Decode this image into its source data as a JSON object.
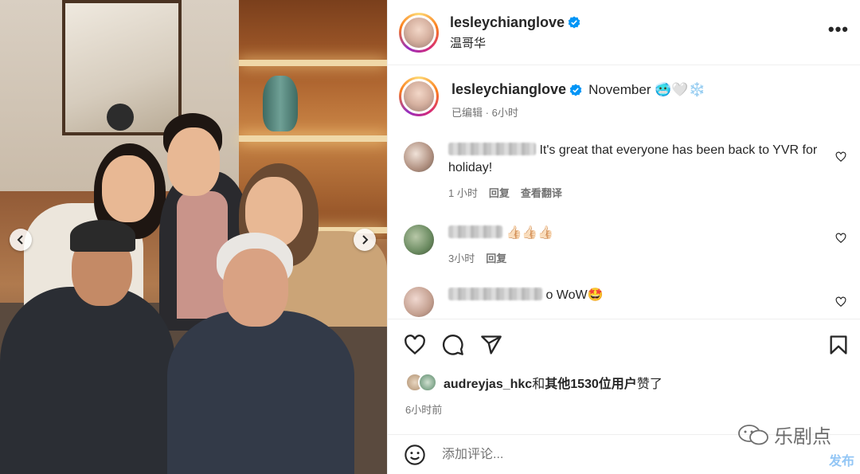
{
  "header": {
    "username": "lesleychianglove",
    "location": "温哥华",
    "more_label": "•••"
  },
  "caption": {
    "username": "lesleychianglove",
    "text": "November 🥶🤍❄️",
    "edited_label": "已编辑",
    "separator": "·",
    "time": "6小时"
  },
  "comments": [
    {
      "text": "It's great that everyone has been back to YVR for holiday!",
      "time": "1 小时",
      "reply_label": "回复",
      "translate_label": "查看翻译"
    },
    {
      "text": "👍🏻👍🏻👍🏻",
      "time": "3小时",
      "reply_label": "回复"
    },
    {
      "text": "o WoW🤩"
    }
  ],
  "likes": {
    "user": "audreyjas_hkc",
    "connector": "和",
    "others": "其他1530位用户",
    "suffix": "赞了"
  },
  "post_time": "6小时前",
  "add_comment": {
    "placeholder": "添加评论...",
    "post_label": "发布"
  },
  "watermark": {
    "text": "乐剧点"
  },
  "colors": {
    "verified": "#0095f6",
    "post_button": "#93c6f5",
    "secondary_text": "#737373"
  },
  "icons": {
    "like": "heart-icon",
    "comment": "comment-icon",
    "share": "share-icon",
    "save": "bookmark-icon",
    "emoji": "smiley-icon",
    "verified": "verified-badge-icon",
    "prev": "chevron-left-icon",
    "next": "chevron-right-icon"
  }
}
